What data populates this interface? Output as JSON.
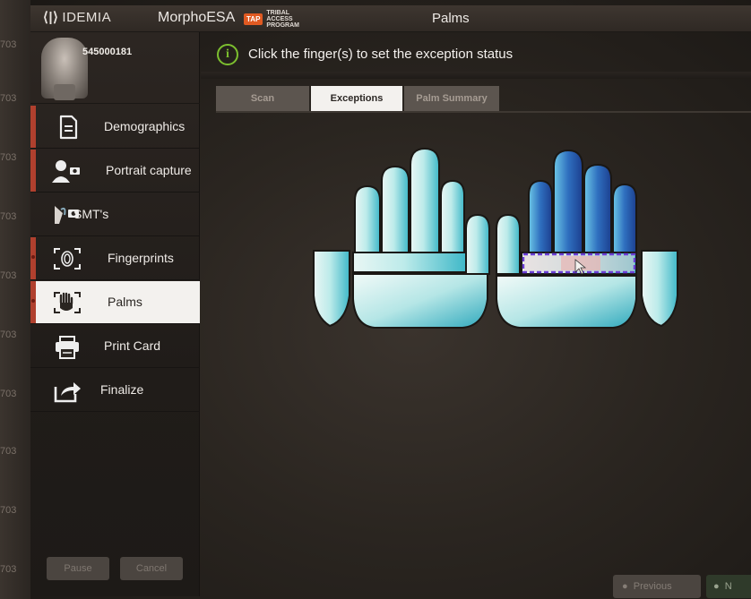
{
  "titlebar": {
    "brand": "IDEMIA",
    "app_name": "MorphoESA",
    "tap_badge": "TAP",
    "tap_text": "TRIBAL\nACCESS\nPROGRAM",
    "window_title": "Palms"
  },
  "bezel": {
    "numbers": [
      "703",
      "703",
      "703",
      "703",
      "703",
      "703",
      "703",
      "703",
      "703",
      "703"
    ]
  },
  "profile": {
    "subject_id": "545000181"
  },
  "sidebar": {
    "items": [
      {
        "label": "Demographics",
        "icon": "document-icon",
        "state": "incomplete"
      },
      {
        "label": "Portrait capture",
        "icon": "portrait-camera-icon",
        "state": "incomplete"
      },
      {
        "label": "SMT's",
        "icon": "smt-camera-icon",
        "state": "none"
      },
      {
        "label": "Fingerprints",
        "icon": "fingerprint-scanner-icon",
        "state": "incomplete"
      },
      {
        "label": "Palms",
        "icon": "palm-scanner-icon",
        "state": "active"
      },
      {
        "label": "Print Card",
        "icon": "printer-icon",
        "state": "none"
      },
      {
        "label": "Finalize",
        "icon": "share-arrow-icon",
        "state": "none"
      }
    ],
    "pause_label": "Pause",
    "cancel_label": "Cancel"
  },
  "main": {
    "instruction": "Click the finger(s) to set the exception status",
    "tabs": [
      {
        "label": "Scan",
        "active": false
      },
      {
        "label": "Exceptions",
        "active": true
      },
      {
        "label": "Palm Summary",
        "active": false
      }
    ],
    "previous_label": "Previous",
    "next_label": "N"
  },
  "colors": {
    "accent_red": "#b0402e",
    "info_green": "#7cbf2f",
    "palm_cyan": "#7fd6dc",
    "finger_blue": "#2f6fbf",
    "selection_purple": "#6a3fd6"
  }
}
